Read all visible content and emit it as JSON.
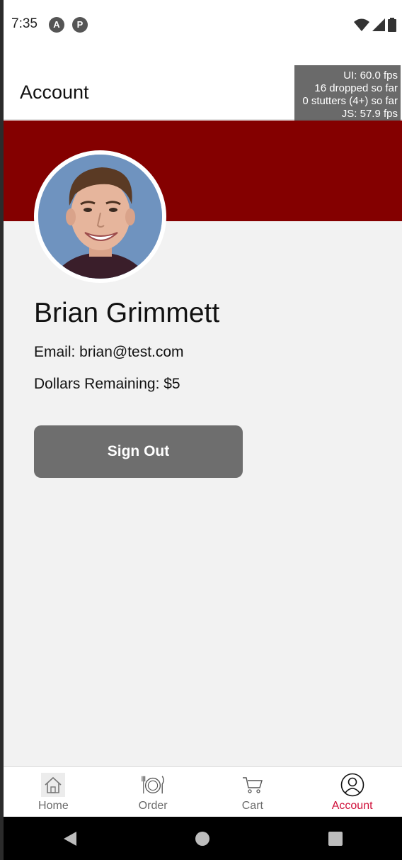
{
  "status_bar": {
    "time": "7:35",
    "app_icons": [
      "A",
      "P"
    ],
    "icons": [
      "wifi-icon",
      "signal-icon",
      "battery-icon"
    ]
  },
  "header": {
    "title": "Account"
  },
  "perf_overlay": {
    "lines": [
      "UI: 60.0 fps",
      "16 dropped so far",
      "0 stutters (4+) so far",
      "JS: 57.9 fps"
    ]
  },
  "profile": {
    "name": "Brian Grimmett",
    "email": "Email: brian@test.com",
    "dollars": "Dollars Remaining: $5",
    "banner_color": "#840000"
  },
  "actions": {
    "sign_out": "Sign Out"
  },
  "tabs": [
    {
      "label": "Home",
      "icon": "home-icon",
      "active": false
    },
    {
      "label": "Order",
      "icon": "plate-icon",
      "active": false
    },
    {
      "label": "Cart",
      "icon": "cart-icon",
      "active": false
    },
    {
      "label": "Account",
      "icon": "user-circle-icon",
      "active": true
    }
  ],
  "colors": {
    "accent": "#d0103a",
    "button": "#6e6e6e"
  }
}
